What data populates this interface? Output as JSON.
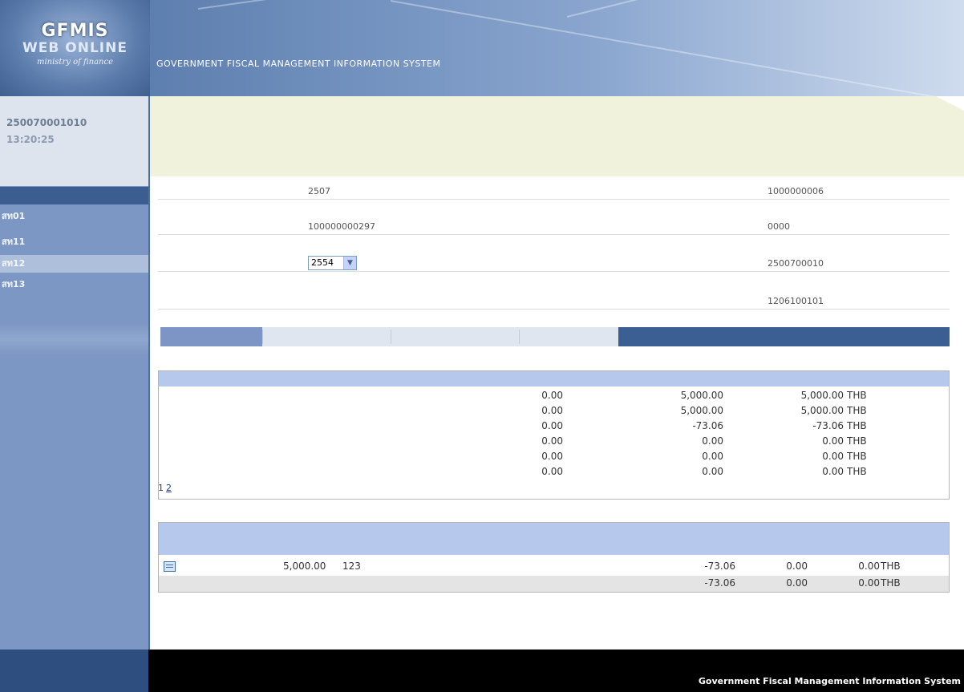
{
  "header": {
    "logo_line1": "GFMIS",
    "logo_line2": "WEB ONLINE",
    "logo_sub": "ministry of finance",
    "title_th": "",
    "title_en": "GOVERNMENT FISCAL MANAGEMENT INFORMATION SYSTEM"
  },
  "user": {
    "id_label": "",
    "id_value": "250070001010",
    "login_label": "",
    "login_time": "13:20:25",
    "links": ""
  },
  "menu": {
    "heading": "",
    "items": [
      {
        "code": "สท01",
        "label": ""
      },
      {
        "code": "สท11",
        "label": ""
      },
      {
        "code": "สท12",
        "label": "",
        "active": true
      },
      {
        "code": "สท13",
        "label": ""
      }
    ],
    "back_home": ""
  },
  "infobar": {
    "recorder": "",
    "position": "",
    "affiliation": ""
  },
  "page": {
    "title": "",
    "subtitle": ""
  },
  "form": {
    "agency_code_label": "",
    "agency_code": "2507",
    "agency_name": "",
    "seller_label": "",
    "seller": "1000000006",
    "main_asset_label": "",
    "main_asset": "100000000297",
    "sub_asset_label": "",
    "sub_asset": "0000",
    "fiscal_year_label": "",
    "fiscal_year": "2554",
    "cost_center_label": "",
    "cost_center": "2500700010",
    "cost_center_name": "",
    "depreciation_area_label": "",
    "depreciation_area": "",
    "account_label": "",
    "account": "1206100101",
    "account_name": ""
  },
  "tabs": [
    "",
    "",
    "",
    ""
  ],
  "table1": {
    "title": "",
    "headers": [
      "",
      "",
      "",
      "",
      ""
    ],
    "rows": [
      {
        "label": "",
        "start": "0.00",
        "change": "5,000.00",
        "end": "5,000.00",
        "cur": "THB"
      },
      {
        "label": "",
        "start": "0.00",
        "change": "5,000.00",
        "end": "5,000.00",
        "cur": "THB"
      },
      {
        "label": "",
        "start": "0.00",
        "change": "-73.06",
        "end": "-73.06",
        "cur": "THB"
      },
      {
        "label": "",
        "start": "0.00",
        "change": "0.00",
        "end": "0.00",
        "cur": "THB"
      },
      {
        "label": "",
        "start": "0.00",
        "change": "0.00",
        "end": "0.00",
        "cur": "THB"
      },
      {
        "label": "",
        "start": "0.00",
        "change": "0.00",
        "end": "0.00",
        "cur": "THB"
      }
    ],
    "pager_current": "1",
    "pager_next": "2"
  },
  "table2": {
    "title": "",
    "headers": {
      "select": "",
      "value_date": "",
      "amount": "",
      "type": "",
      "type_text": "",
      "dep_txn": "",
      "dep_accum": "",
      "dep_year": "",
      "currency": ""
    },
    "row": {
      "date": "",
      "amount": "5,000.00",
      "type": "123",
      "text": "",
      "dep_txn": "-73.06",
      "dep_accum": "0.00",
      "dep_year": "0.00",
      "cur": "THB"
    },
    "sum": {
      "dep_txn": "-73.06",
      "dep_accum": "0.00",
      "dep_year": "0.00",
      "cur": "THB"
    }
  },
  "footer": {
    "line_th": "",
    "line_en": "Government Fiscal Management Information System"
  }
}
